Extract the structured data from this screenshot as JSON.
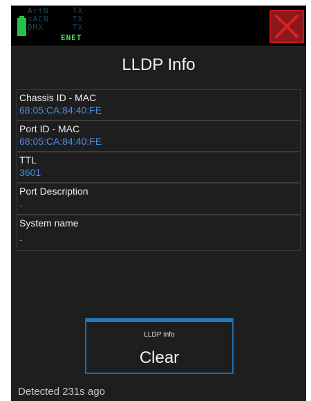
{
  "topbar": {
    "protocols": [
      {
        "label": "ArtN",
        "state": "TX"
      },
      {
        "label": "sACN",
        "state": "TX"
      },
      {
        "label": "DMX",
        "state": "TX"
      }
    ],
    "network": "ENET",
    "battery_color": "#24c04a",
    "close_icon": "close-x-icon",
    "close_color": "#c21a1a"
  },
  "page": {
    "title": "LLDP Info"
  },
  "info": [
    {
      "label": "Chassis ID - MAC",
      "value": "68:05:CA:84:40:FE"
    },
    {
      "label": "Port ID - MAC",
      "value": "68:05:CA:84:40:FE"
    },
    {
      "label": "TTL",
      "value": "3601"
    },
    {
      "label": "Port Description",
      "value": "-"
    },
    {
      "label": "System name",
      "value": "-"
    }
  ],
  "clear_button": {
    "caption": "LLDP Info",
    "label": "Clear",
    "accent": "#1a6fb0"
  },
  "status": {
    "text": "Detected 231s ago"
  }
}
